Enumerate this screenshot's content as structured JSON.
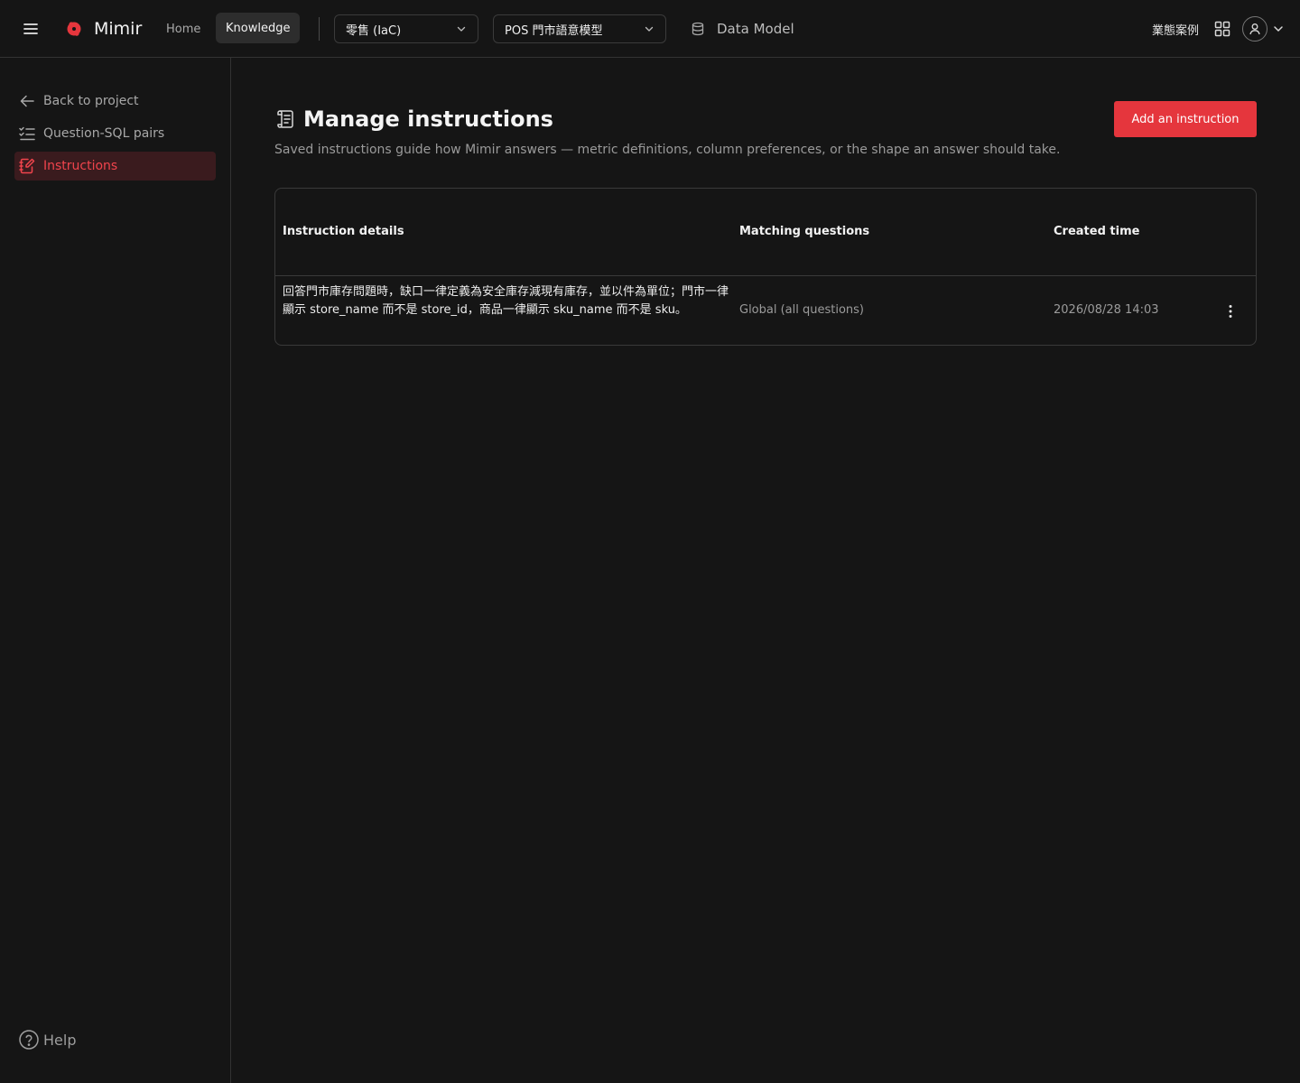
{
  "header": {
    "app_name": "Mimir",
    "nav": {
      "home": "Home",
      "knowledge": "Knowledge"
    },
    "project_select": {
      "value": "零售 (IaC)"
    },
    "model_select": {
      "value": "POS 門市語意模型"
    },
    "data_model_link": "Data Model",
    "biz_cases_link": "業態案例",
    "icons": [
      "menu-icon",
      "logo-icon",
      "chevron-down-icon",
      "database-icon",
      "apps-grid-icon",
      "user-icon"
    ]
  },
  "sidebar": {
    "items": [
      {
        "label": "Back to project",
        "icon": "arrow-left-icon"
      },
      {
        "label": "Question-SQL pairs",
        "icon": "checklist-icon"
      },
      {
        "label": "Instructions",
        "icon": "notebook-edit-icon",
        "active": true
      }
    ],
    "help": "Help"
  },
  "main": {
    "title": "Manage instructions",
    "description": "Saved instructions guide how Mimir answers — metric definitions, column preferences, or the shape an answer should take.",
    "add_button": "Add an instruction",
    "table": {
      "columns": [
        "Instruction details",
        "Matching questions",
        "Created time"
      ],
      "rows": [
        {
          "details": "回答門市庫存問題時，缺口一律定義為安全庫存減現有庫存，並以件為單位；門市一律顯示 store_name 而不是 store_id，商品一律顯示 sku_name 而不是 sku。",
          "matching": "Global (all questions)",
          "created": "2026/08/28 14:03"
        }
      ]
    }
  },
  "colors": {
    "background": "#151515",
    "accent": "#e5363d",
    "active_item_bg": "#3a1b1e",
    "active_item_text": "#f0444c",
    "border": "#3a3a3a"
  }
}
